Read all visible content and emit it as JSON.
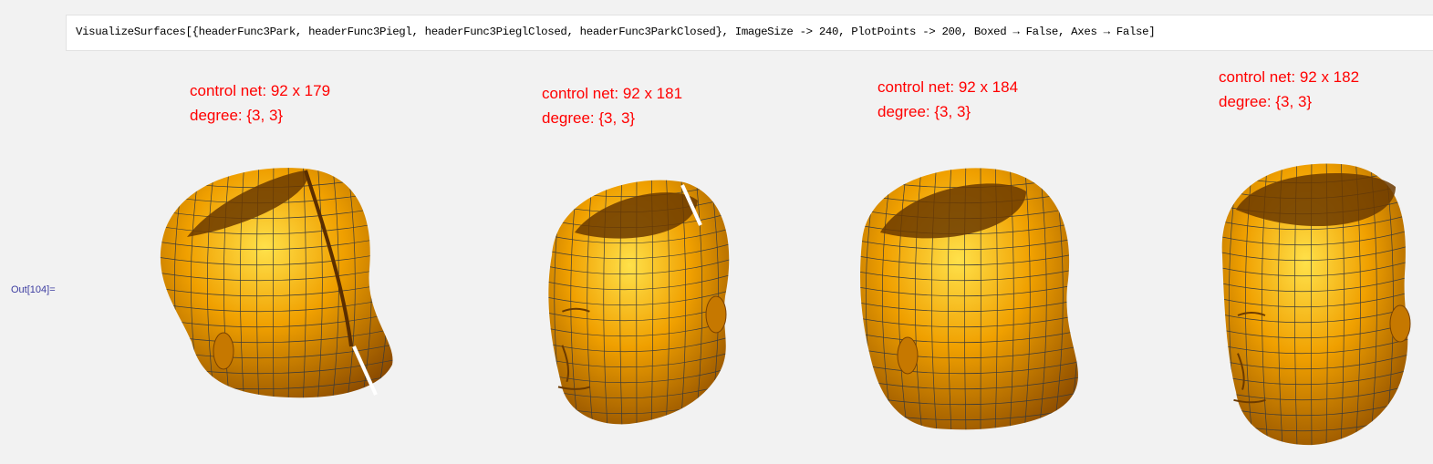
{
  "input": {
    "code": "VisualizeSurfaces[{headerFunc3Park, headerFunc3Piegl, headerFunc3PieglClosed, headerFunc3ParkClosed}, ImageSize -> 240, PlotPoints -> 200, Boxed → False, Axes → False]"
  },
  "output": {
    "label": "Out[104]=",
    "plots": [
      {
        "control_net": "control net: 92 x 179",
        "degree": "degree: {3, 3}",
        "view": "back-left",
        "seam": true
      },
      {
        "control_net": "control net: 92 x 181",
        "degree": "degree: {3, 3}",
        "view": "front-left",
        "seam": true
      },
      {
        "control_net": "control net: 92 x 184",
        "degree": "degree: {3, 3}",
        "view": "back-left",
        "seam": false
      },
      {
        "control_net": "control net: 92 x 182",
        "degree": "degree: {3, 3}",
        "view": "front-left",
        "seam": false
      }
    ],
    "surface_color": "#f0a000",
    "caption_color": "#ff0000"
  }
}
